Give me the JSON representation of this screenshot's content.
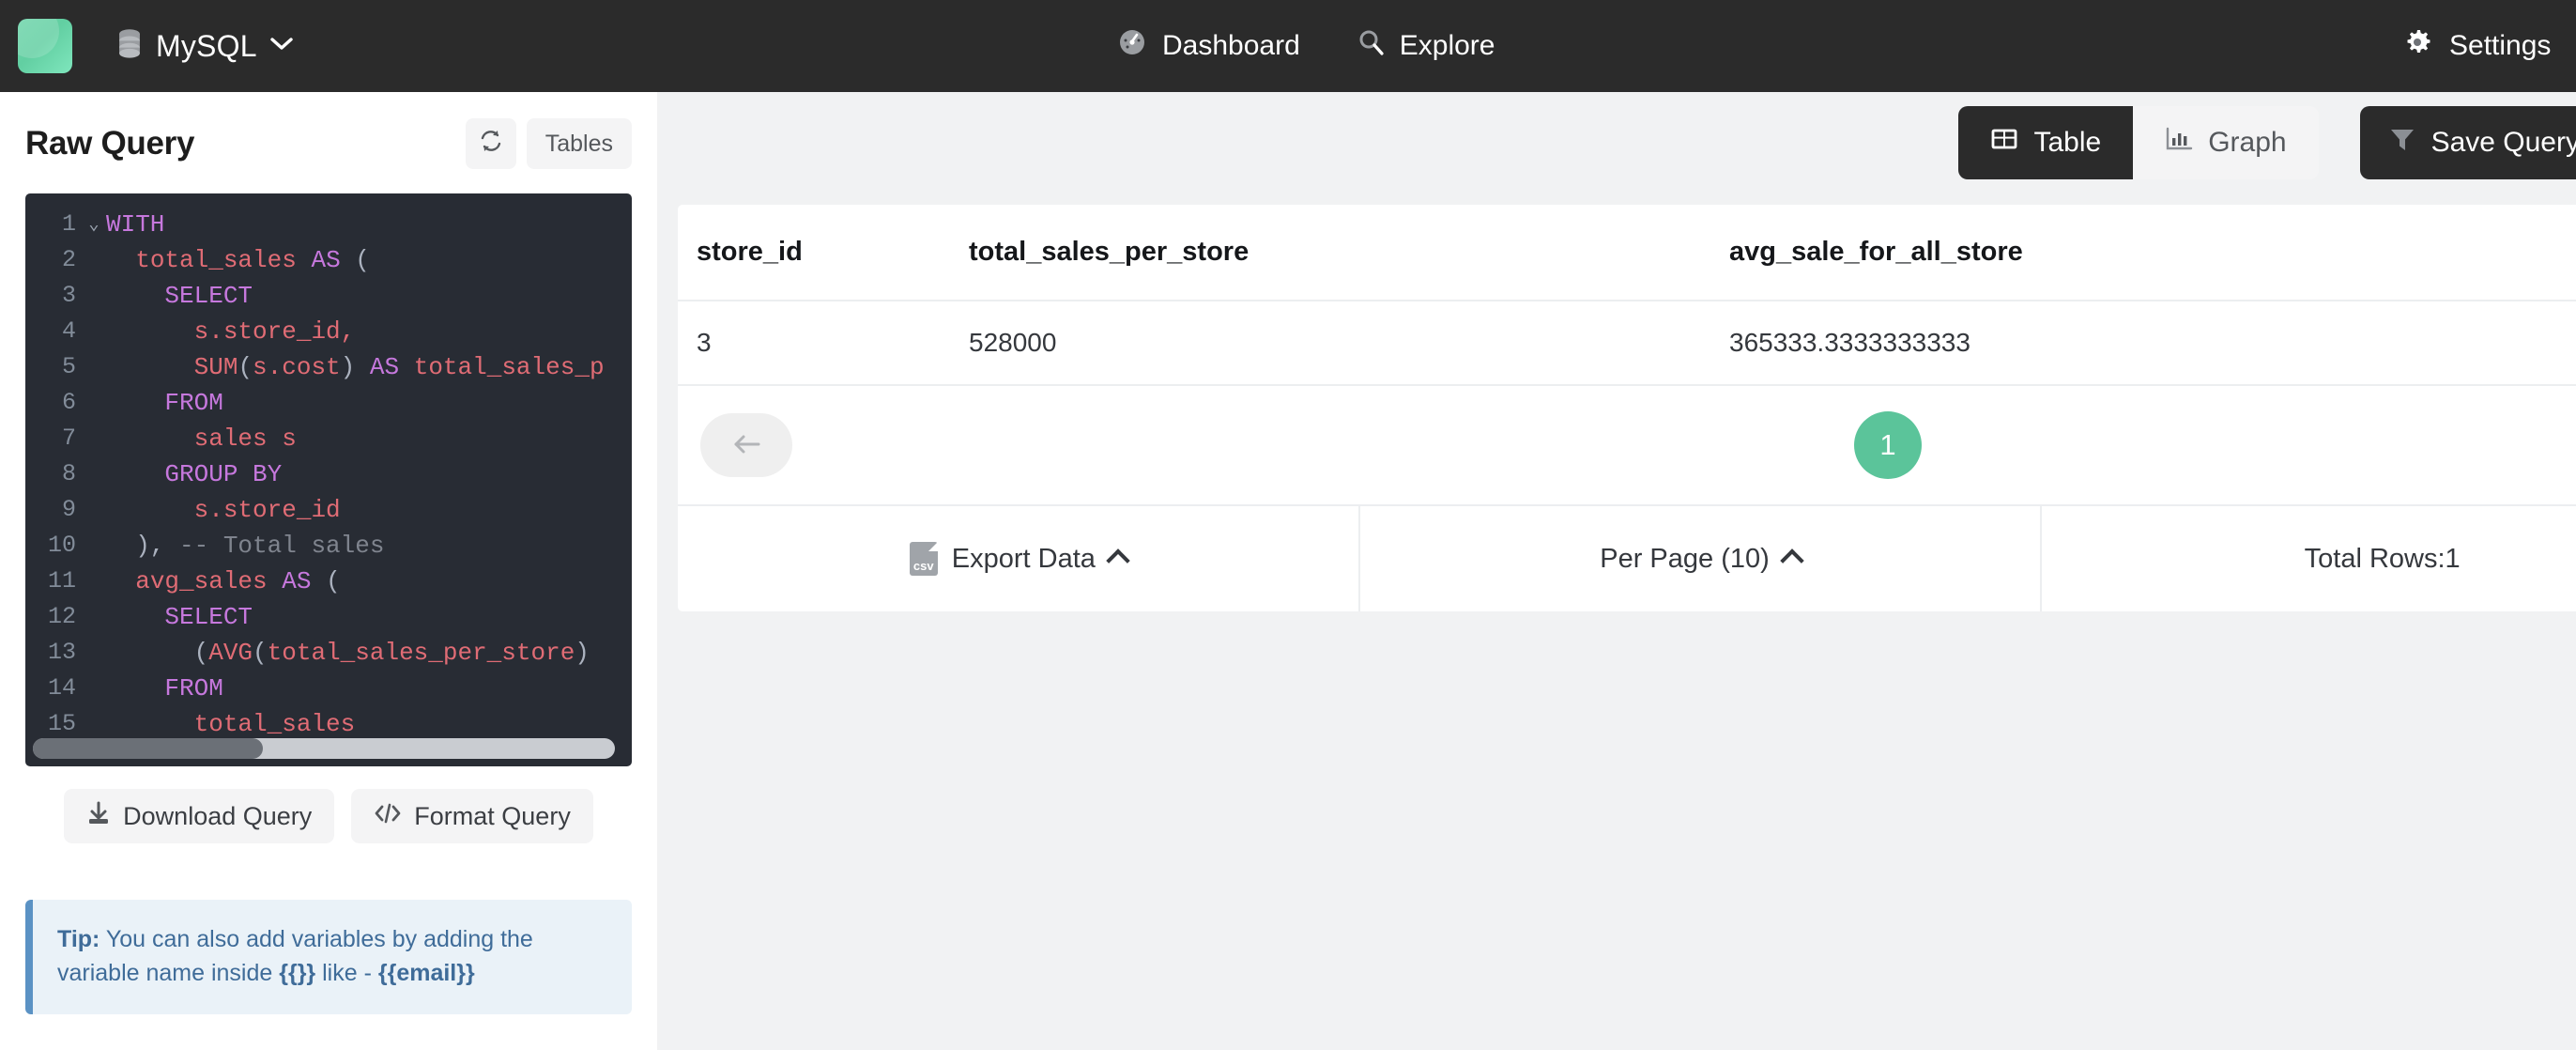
{
  "topbar": {
    "logo_icon": "app-logo-icon",
    "database": {
      "icon": "database-icon",
      "label": "MySQL",
      "chevron_icon": "chevron-down-icon"
    },
    "nav": [
      {
        "icon": "dashboard-gauge-icon",
        "label": "Dashboard"
      },
      {
        "icon": "search-icon",
        "label": "Explore"
      }
    ],
    "settings": {
      "icon": "gear-icon",
      "label": "Settings"
    }
  },
  "sidebar": {
    "title": "Raw Query",
    "refresh_icon": "refresh-icon",
    "tables_button": "Tables",
    "editor": {
      "lines": [
        {
          "n": "1",
          "fold": "⌄",
          "tokens": [
            {
              "t": "kw",
              "v": "WITH"
            }
          ]
        },
        {
          "n": "2",
          "fold": "",
          "tokens": [
            {
              "t": "pun",
              "v": "  "
            },
            {
              "t": "id",
              "v": "total_sales"
            },
            {
              "t": "pun",
              "v": " "
            },
            {
              "t": "kw",
              "v": "AS"
            },
            {
              "t": "pun",
              "v": " ("
            }
          ]
        },
        {
          "n": "3",
          "fold": "",
          "tokens": [
            {
              "t": "pun",
              "v": "    "
            },
            {
              "t": "kw",
              "v": "SELECT"
            }
          ]
        },
        {
          "n": "4",
          "fold": "",
          "tokens": [
            {
              "t": "pun",
              "v": "      "
            },
            {
              "t": "id",
              "v": "s.store_id,"
            }
          ]
        },
        {
          "n": "5",
          "fold": "",
          "tokens": [
            {
              "t": "pun",
              "v": "      "
            },
            {
              "t": "id",
              "v": "SUM"
            },
            {
              "t": "pun",
              "v": "("
            },
            {
              "t": "id",
              "v": "s.cost"
            },
            {
              "t": "pun",
              "v": ") "
            },
            {
              "t": "kw",
              "v": "AS"
            },
            {
              "t": "pun",
              "v": " "
            },
            {
              "t": "id",
              "v": "total_sales_p"
            }
          ]
        },
        {
          "n": "6",
          "fold": "",
          "tokens": [
            {
              "t": "pun",
              "v": "    "
            },
            {
              "t": "kw",
              "v": "FROM"
            }
          ]
        },
        {
          "n": "7",
          "fold": "",
          "tokens": [
            {
              "t": "pun",
              "v": "      "
            },
            {
              "t": "id",
              "v": "sales s"
            }
          ]
        },
        {
          "n": "8",
          "fold": "",
          "tokens": [
            {
              "t": "pun",
              "v": "    "
            },
            {
              "t": "kw",
              "v": "GROUP BY"
            }
          ]
        },
        {
          "n": "9",
          "fold": "",
          "tokens": [
            {
              "t": "pun",
              "v": "      "
            },
            {
              "t": "id",
              "v": "s.store_id"
            }
          ]
        },
        {
          "n": "10",
          "fold": "",
          "tokens": [
            {
              "t": "pun",
              "v": "  ), "
            },
            {
              "t": "cmt",
              "v": "-- Total sales"
            }
          ]
        },
        {
          "n": "11",
          "fold": "",
          "tokens": [
            {
              "t": "pun",
              "v": "  "
            },
            {
              "t": "id",
              "v": "avg_sales"
            },
            {
              "t": "pun",
              "v": " "
            },
            {
              "t": "kw",
              "v": "AS"
            },
            {
              "t": "pun",
              "v": " ("
            }
          ]
        },
        {
          "n": "12",
          "fold": "",
          "tokens": [
            {
              "t": "pun",
              "v": "    "
            },
            {
              "t": "kw",
              "v": "SELECT"
            }
          ]
        },
        {
          "n": "13",
          "fold": "",
          "tokens": [
            {
              "t": "pun",
              "v": "      ("
            },
            {
              "t": "id",
              "v": "AVG"
            },
            {
              "t": "pun",
              "v": "("
            },
            {
              "t": "id",
              "v": "total_sales_per_store"
            },
            {
              "t": "pun",
              "v": ")"
            }
          ]
        },
        {
          "n": "14",
          "fold": "",
          "tokens": [
            {
              "t": "pun",
              "v": "    "
            },
            {
              "t": "kw",
              "v": "FROM"
            }
          ]
        },
        {
          "n": "15",
          "fold": "",
          "tokens": [
            {
              "t": "pun",
              "v": "      "
            },
            {
              "t": "id",
              "v": "total_sales"
            }
          ]
        }
      ]
    },
    "actions": [
      {
        "icon": "download-icon",
        "label": "Download Query"
      },
      {
        "icon": "code-brackets-icon",
        "label": "Format Query"
      }
    ],
    "tip": {
      "prefix": "Tip:",
      "text_1": " You can also add variables by adding the variable name inside ",
      "code_1": "{{}}",
      "text_2": " like - ",
      "code_2": "{{email}}"
    }
  },
  "main": {
    "view_toggle": [
      {
        "icon": "table-grid-icon",
        "label": "Table",
        "active": true
      },
      {
        "icon": "bar-chart-icon",
        "label": "Graph",
        "active": false
      }
    ],
    "save_query": {
      "icon": "funnel-icon",
      "label": "Save Query"
    },
    "results": {
      "columns": [
        "store_id",
        "total_sales_per_store",
        "avg_sale_for_all_store"
      ],
      "rows": [
        [
          "3",
          "528000",
          "365333.3333333333"
        ]
      ],
      "pagination": {
        "prev_icon": "arrow-left-icon",
        "next_icon": "arrow-right-icon",
        "current_page": "1"
      },
      "footer": {
        "export": {
          "icon": "csv-file-icon",
          "label": "Export Data",
          "chevron_icon": "chevron-up-icon"
        },
        "per_page": {
          "label": "Per Page (10)",
          "chevron_icon": "chevron-up-icon"
        },
        "total_rows": "Total Rows:1"
      }
    }
  },
  "colors": {
    "accent_green": "#5bc49a",
    "topbar_dark": "#2b2b2b",
    "editor_bg": "#282c34",
    "page_bg": "#f1f2f3",
    "tip_bg": "#eaf2f8",
    "tip_border": "#5b92c4"
  }
}
